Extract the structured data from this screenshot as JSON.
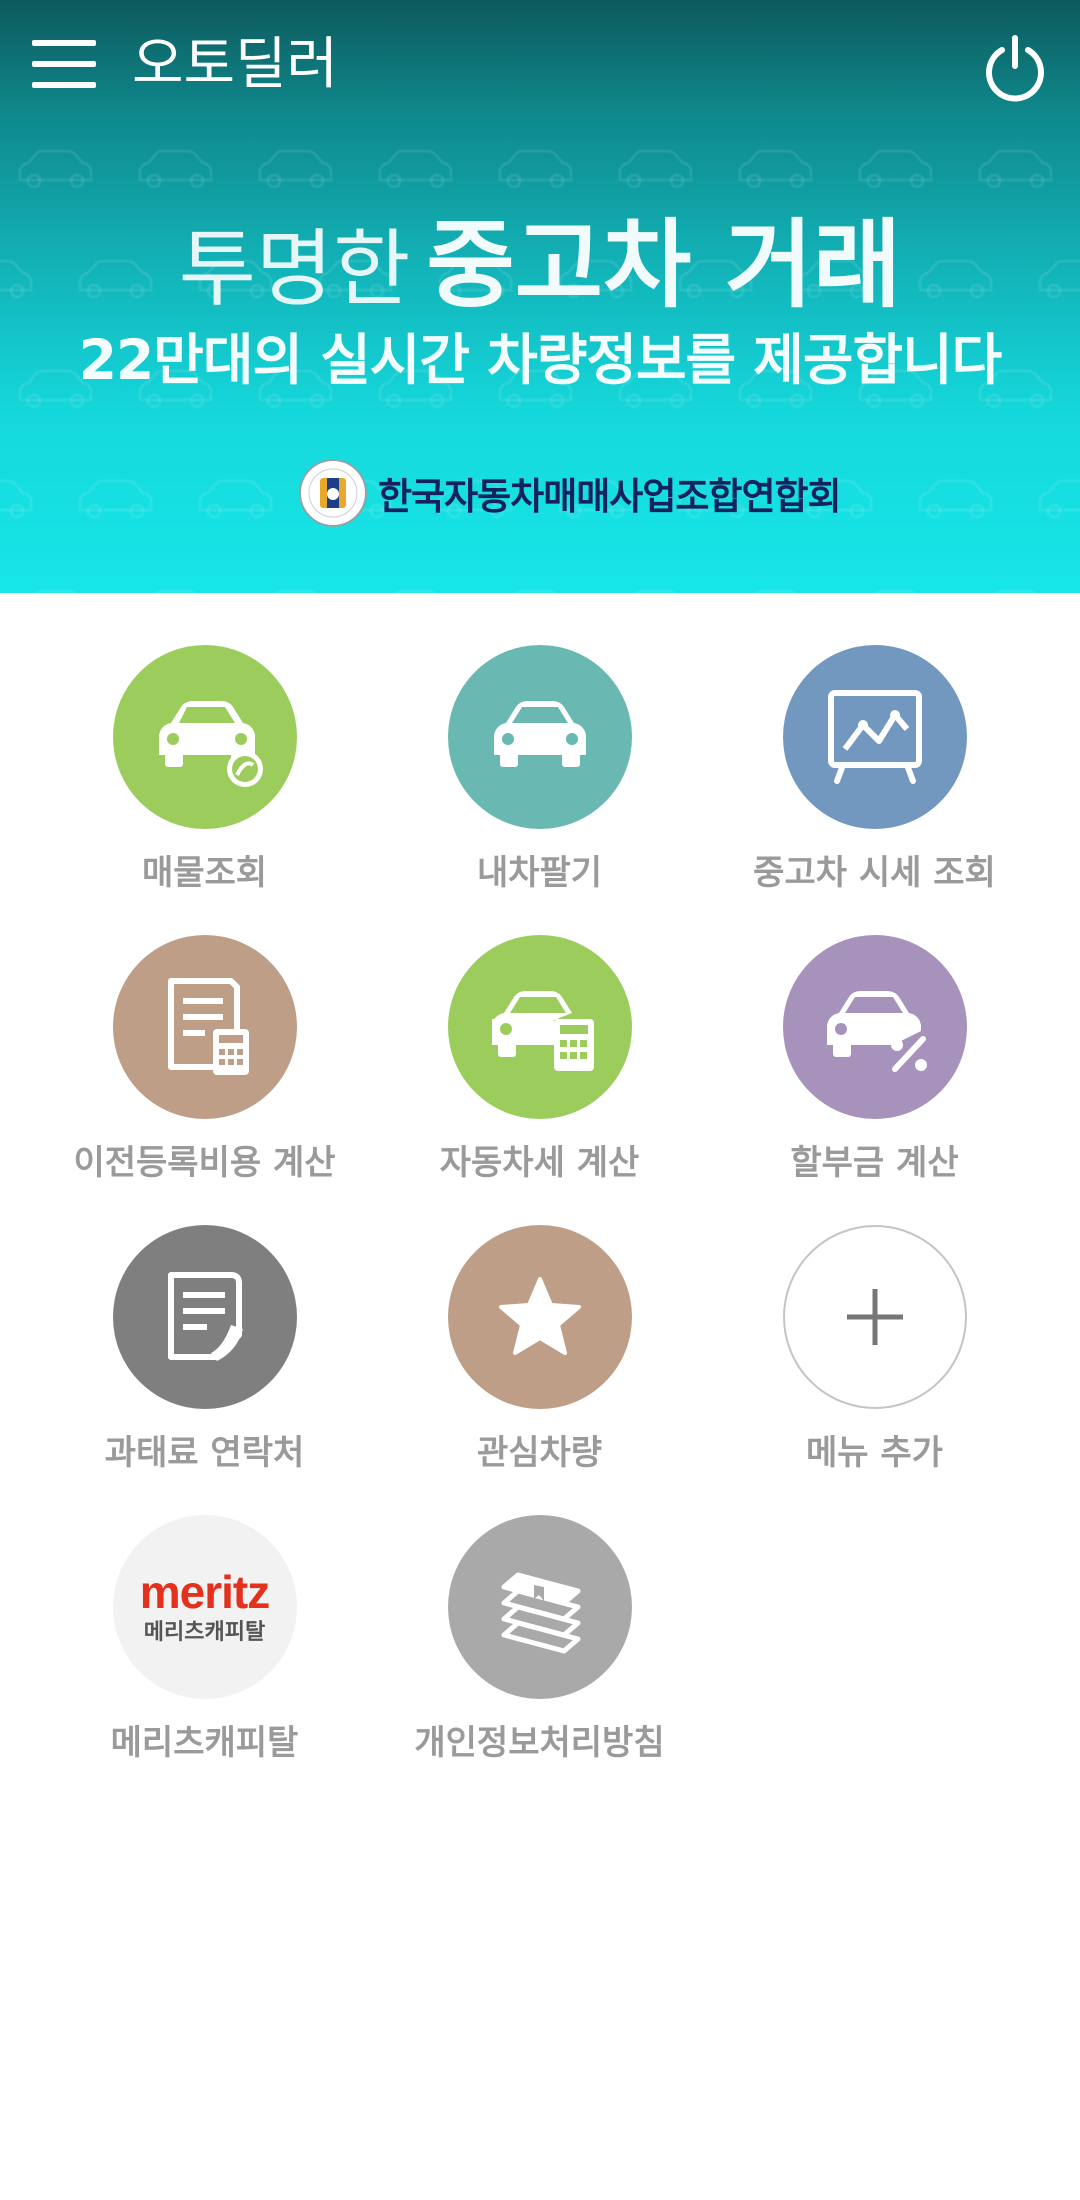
{
  "header": {
    "app_title": "오토딜러",
    "menu_icon": "hamburger-menu-icon",
    "power_icon": "power-icon"
  },
  "banner": {
    "headline_light": "투명한",
    "headline_bold": "중고차 거래",
    "subline": "22만대의 실시간 차량정보를 제공합니다",
    "association": "한국자동차매매사업조합연합회",
    "gradient_top": "#0d5a5c",
    "gradient_bottom": "#17e6e8"
  },
  "menu_items": [
    {
      "label": "매물조회",
      "icon": "car-search-icon",
      "color": "#9ccc5c"
    },
    {
      "label": "내차팔기",
      "icon": "car-icon",
      "color": "#6ab8b2"
    },
    {
      "label": "중고차 시세 조회",
      "icon": "price-chart-icon",
      "color": "#7398c0"
    },
    {
      "label": "이전등록비용 계산",
      "icon": "document-calculator-icon",
      "color": "#be9e87"
    },
    {
      "label": "자동차세 계산",
      "icon": "car-calculator-icon",
      "color": "#9ccc5c"
    },
    {
      "label": "할부금 계산",
      "icon": "car-percent-icon",
      "color": "#a792bc"
    },
    {
      "label": "과태료 연락처",
      "icon": "document-phone-icon",
      "color": "#7f7f7f"
    },
    {
      "label": "관심차량",
      "icon": "star-icon",
      "color": "#be9e87"
    },
    {
      "label": "메뉴 추가",
      "icon": "plus-icon",
      "color": "#ffffff"
    },
    {
      "label": "메리츠캐피탈",
      "icon": "meritz-logo",
      "logo_word": "meritz",
      "logo_sub": "메리츠캐피탈",
      "color": "#f2f2f2"
    },
    {
      "label": "개인정보처리방침",
      "icon": "book-stack-icon",
      "color": "#a9a9a9"
    }
  ]
}
